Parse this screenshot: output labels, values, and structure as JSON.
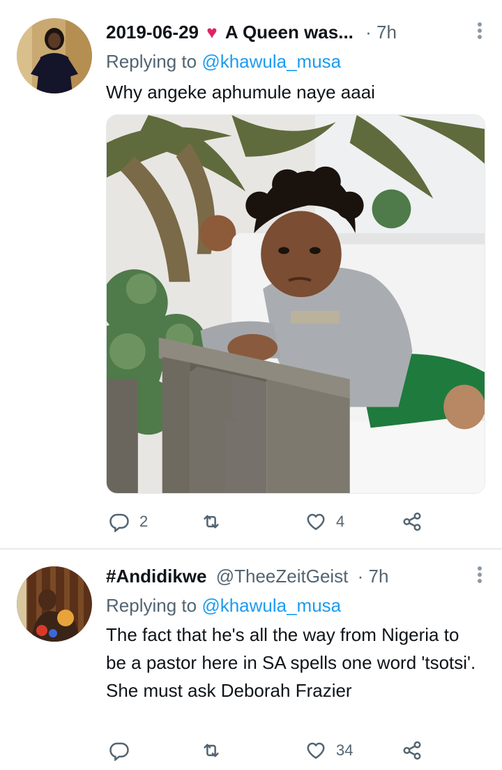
{
  "tweets": [
    {
      "display_name": "2019-06-29",
      "name_suffix": "A Queen was...",
      "handle": "",
      "time": "· 7h",
      "replying_label": "Replying to",
      "replying_handle": "@khawula_musa",
      "text": "Why angeke aphumule naye aaai",
      "replies": "2",
      "retweets": "",
      "likes": "4",
      "has_media": true
    },
    {
      "display_name": "#Andidikwe",
      "name_suffix": "",
      "handle": "@TheeZeitGeist",
      "time": "· 7h",
      "replying_label": "Replying to",
      "replying_handle": "@khawula_musa",
      "text": "The fact that he's all the way from Nigeria to be a pastor here in SA spells one word 'tsotsi'. She must ask Deborah Frazier",
      "replies": "",
      "retweets": "",
      "likes": "34",
      "has_media": false
    }
  ],
  "icons": {
    "reply": "reply-icon",
    "retweet": "retweet-icon",
    "like": "heart-outline-icon",
    "share": "share-icon",
    "more": "more-vertical-icon",
    "heart_emoji": "red-heart-icon"
  },
  "colors": {
    "link": "#1d9bf0",
    "secondary_text": "#536471",
    "heart": "#e0245e"
  }
}
